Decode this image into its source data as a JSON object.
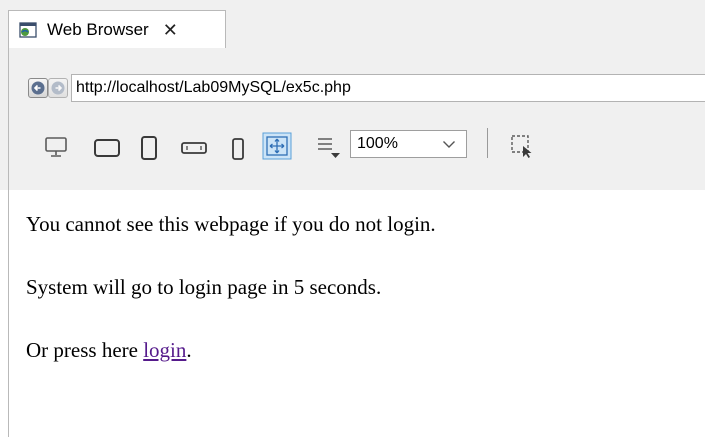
{
  "tab": {
    "title": "Web Browser",
    "close_glyph": "✕",
    "icon": "browser-window-icon"
  },
  "nav": {
    "back_icon": "back-arrow-icon",
    "forward_icon": "forward-arrow-icon",
    "url": "http://localhost/Lab09MySQL/ex5c.php"
  },
  "toolbar": {
    "tools": [
      "desktop-icon",
      "tablet-landscape-icon",
      "tablet-portrait-icon",
      "phone-landscape-icon",
      "phone-portrait-icon",
      "fit-to-window-icon",
      "line-spacing-icon",
      "inspect-icon"
    ],
    "zoom": "100%"
  },
  "page": {
    "line1": "You cannot see this webpage if you do not login.",
    "line2": "System will go to login page in 5 seconds.",
    "line3_prefix": "Or press here ",
    "link_text": "login",
    "line3_suffix": "."
  },
  "colors": {
    "link_visited": "#551a8b",
    "chrome_bg": "#f0f0f0",
    "active_tool_bg": "#cce4f7"
  }
}
